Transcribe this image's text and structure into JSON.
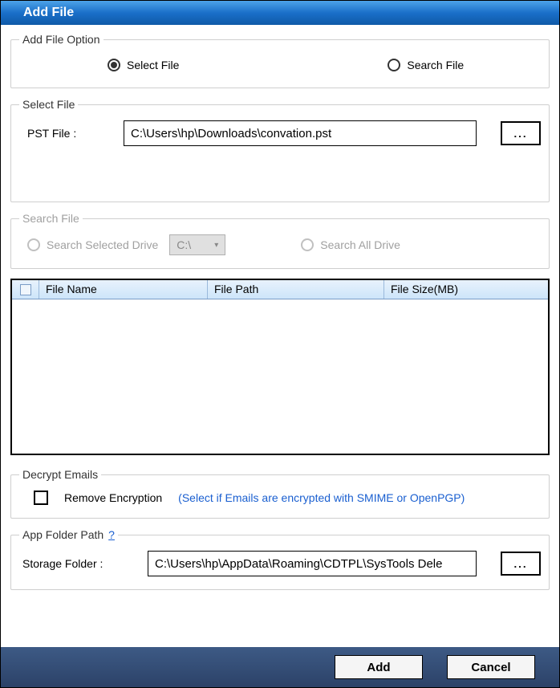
{
  "window": {
    "title": "Add File"
  },
  "addFileOption": {
    "legend": "Add File Option",
    "selectFileLabel": "Select File",
    "searchFileLabel": "Search File"
  },
  "selectFile": {
    "legend": "Select File",
    "pstLabel": "PST File :",
    "pstValue": "C:\\Users\\hp\\Downloads\\convation.pst",
    "browseLabel": "..."
  },
  "searchFile": {
    "legend": "Search File",
    "searchSelectedLabel": "Search Selected Drive",
    "driveValue": "C:\\",
    "searchAllLabel": "Search All Drive"
  },
  "table": {
    "colFileName": "File Name",
    "colFilePath": "File Path",
    "colFileSize": "File Size(MB)"
  },
  "decrypt": {
    "legend": "Decrypt Emails",
    "removeLabel": "Remove Encryption",
    "hint": "(Select if Emails are encrypted with SMIME or OpenPGP)"
  },
  "appFolder": {
    "legend": "App Folder Path",
    "help": "?",
    "storageLabel": "Storage Folder    :",
    "storageValue": "C:\\Users\\hp\\AppData\\Roaming\\CDTPL\\SysTools Dele",
    "browseLabel": "..."
  },
  "actions": {
    "add": "Add",
    "cancel": "Cancel"
  }
}
